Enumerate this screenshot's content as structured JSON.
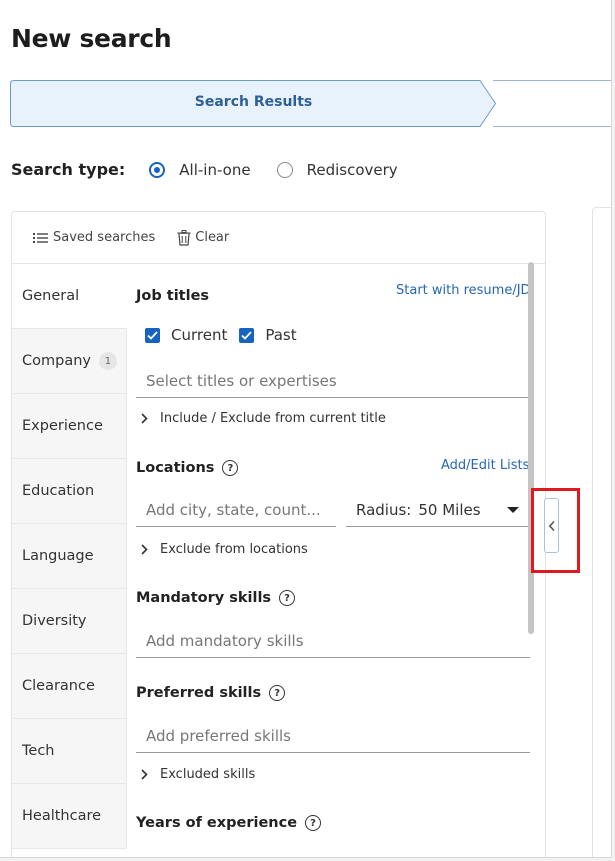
{
  "page": {
    "title": "New search"
  },
  "stepper": {
    "active_step": "Search Results"
  },
  "search_type": {
    "label": "Search type:",
    "options": [
      {
        "label": "All-in-one",
        "selected": true
      },
      {
        "label": "Rediscovery",
        "selected": false
      }
    ]
  },
  "toolbar": {
    "saved_searches": "Saved searches",
    "clear": "Clear"
  },
  "side_nav": [
    {
      "label": "General",
      "active": true
    },
    {
      "label": "Company",
      "badge": "1"
    },
    {
      "label": "Experience"
    },
    {
      "label": "Education"
    },
    {
      "label": "Language"
    },
    {
      "label": "Diversity"
    },
    {
      "label": "Clearance"
    },
    {
      "label": "Tech"
    },
    {
      "label": "Healthcare"
    }
  ],
  "job_titles": {
    "title": "Job titles",
    "link": "Start with resume/JD",
    "checkboxes": [
      {
        "label": "Current",
        "checked": true
      },
      {
        "label": "Past",
        "checked": true
      }
    ],
    "placeholder": "Select titles or expertises",
    "expander": "Include / Exclude from current title"
  },
  "locations": {
    "title": "Locations",
    "link": "Add/Edit Lists",
    "placeholder": "Add city, state, count...",
    "radius_label": "Radius:",
    "radius_value": "50 Miles",
    "expander": "Exclude from locations"
  },
  "mandatory_skills": {
    "title": "Mandatory skills",
    "placeholder": "Add mandatory skills"
  },
  "preferred_skills": {
    "title": "Preferred skills",
    "placeholder": "Add preferred skills",
    "expander": "Excluded skills"
  },
  "years_of_experience": {
    "title": "Years of experience"
  },
  "colors": {
    "accent": "#1763c0",
    "link": "#2566b5",
    "stepper_fill": "#e8f2fc",
    "highlight": "#e01822"
  }
}
